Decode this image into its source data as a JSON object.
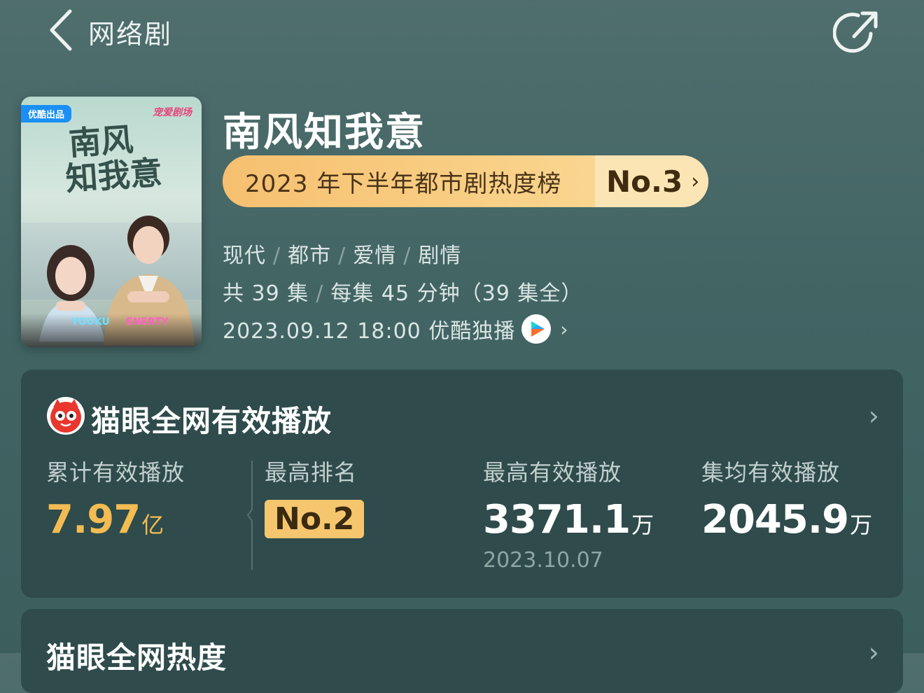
{
  "header": {
    "title": "网络剧",
    "back_icon": "chevron-left-icon",
    "share_icon": "share-icon"
  },
  "poster": {
    "badge_left": "优酷出品",
    "badge_right": "宠爱剧场",
    "calligraphy_line1": "南风",
    "calligraphy_line2": "知我意",
    "logo_text_1": "YOUKU",
    "logo_text_2": "ENERTY"
  },
  "drama": {
    "name": "南风知我意",
    "rank_text": "2023 年下半年都市剧热度榜",
    "rank_no": "No.3",
    "tags": [
      "现代",
      "都市",
      "爱情",
      "剧情"
    ],
    "episodes": "共 39 集",
    "duration": "每集 45 分钟（39 集全）",
    "premiere": "2023.09.12 18:00 优酷独播"
  },
  "stats_card": {
    "title": "猫眼全网有效播放",
    "items": [
      {
        "label": "累计有效播放",
        "value": "7.97",
        "unit": "亿"
      },
      {
        "label": "最高排名",
        "value": "No.2"
      },
      {
        "label": "最高有效播放",
        "value": "3371.1",
        "unit": "万",
        "sub": "2023.10.07"
      },
      {
        "label": "集均有效播放",
        "value": "2045.9",
        "unit": "万"
      }
    ]
  },
  "heat_card": {
    "title": "猫眼全网热度"
  },
  "colors": {
    "background": "#466867",
    "card": "#2f4b4b",
    "accent_gold": "#f3bc52",
    "pill": "#f8ca7c"
  }
}
